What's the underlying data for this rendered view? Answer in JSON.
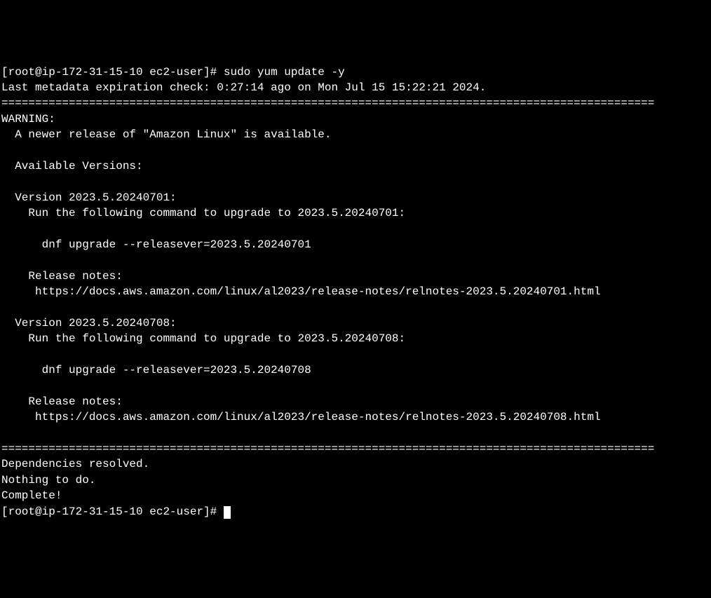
{
  "prompt1": "[root@ip-172-31-15-10 ec2-user]# ",
  "command1": "sudo yum update -y",
  "metadata_line": "Last metadata expiration check: 0:27:14 ago on Mon Jul 15 15:22:21 2024.",
  "separator": "=================================================================================================",
  "warning_header": "WARNING:",
  "warning_body": "  A newer release of \"Amazon Linux\" is available.",
  "available_header": "  Available Versions:",
  "version1_header": "  Version 2023.5.20240701:",
  "version1_run": "    Run the following command to upgrade to 2023.5.20240701:",
  "version1_cmd": "      dnf upgrade --releasever=2023.5.20240701",
  "version1_notes_label": "    Release notes:",
  "version1_notes_url": "     https://docs.aws.amazon.com/linux/al2023/release-notes/relnotes-2023.5.20240701.html",
  "version2_header": "  Version 2023.5.20240708:",
  "version2_run": "    Run the following command to upgrade to 2023.5.20240708:",
  "version2_cmd": "      dnf upgrade --releasever=2023.5.20240708",
  "version2_notes_label": "    Release notes:",
  "version2_notes_url": "     https://docs.aws.amazon.com/linux/al2023/release-notes/relnotes-2023.5.20240708.html",
  "deps_resolved": "Dependencies resolved.",
  "nothing_to_do": "Nothing to do.",
  "complete": "Complete!",
  "prompt2": "[root@ip-172-31-15-10 ec2-user]# "
}
